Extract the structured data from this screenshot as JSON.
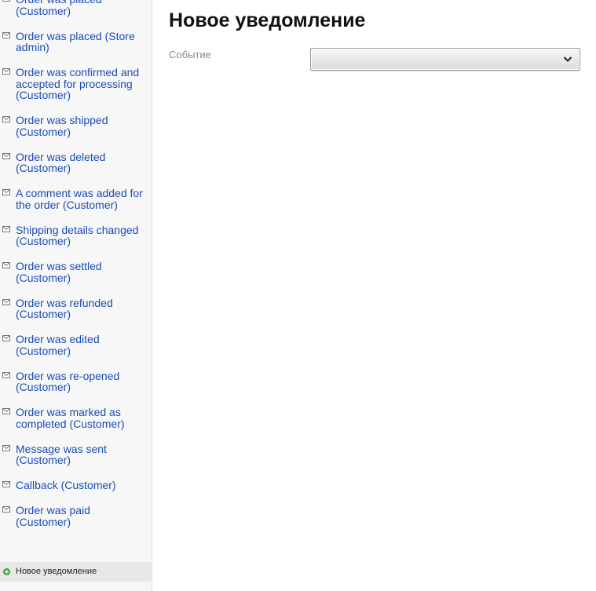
{
  "sidebar": {
    "items": [
      {
        "label": "Order was placed (Customer)"
      },
      {
        "label": "Order was placed (Store admin)"
      },
      {
        "label": "Order was confirmed and accepted for processing (Customer)"
      },
      {
        "label": "Order was shipped (Customer)"
      },
      {
        "label": "Order was deleted (Customer)"
      },
      {
        "label": "A comment was added for the order (Customer)"
      },
      {
        "label": "Shipping details changed (Customer)"
      },
      {
        "label": "Order was settled (Customer)"
      },
      {
        "label": "Order was refunded (Customer)"
      },
      {
        "label": "Order was edited (Customer)"
      },
      {
        "label": "Order was re-opened (Customer)"
      },
      {
        "label": "Order was marked as completed (Customer)"
      },
      {
        "label": "Message was sent (Customer)"
      },
      {
        "label": "Callback (Customer)"
      },
      {
        "label": "Order was paid (Customer)"
      }
    ],
    "item_icon": "envelope-icon",
    "new_item_label": "Новое уведомление",
    "new_item_icon": "plus-circle-icon"
  },
  "main": {
    "title": "Новое уведомление",
    "event_field": {
      "label": "Событие",
      "value": ""
    }
  },
  "colors": {
    "link": "#1a4bb8",
    "sidebar_bg": "#f7f7f7",
    "add_icon": "#3aa83a"
  }
}
